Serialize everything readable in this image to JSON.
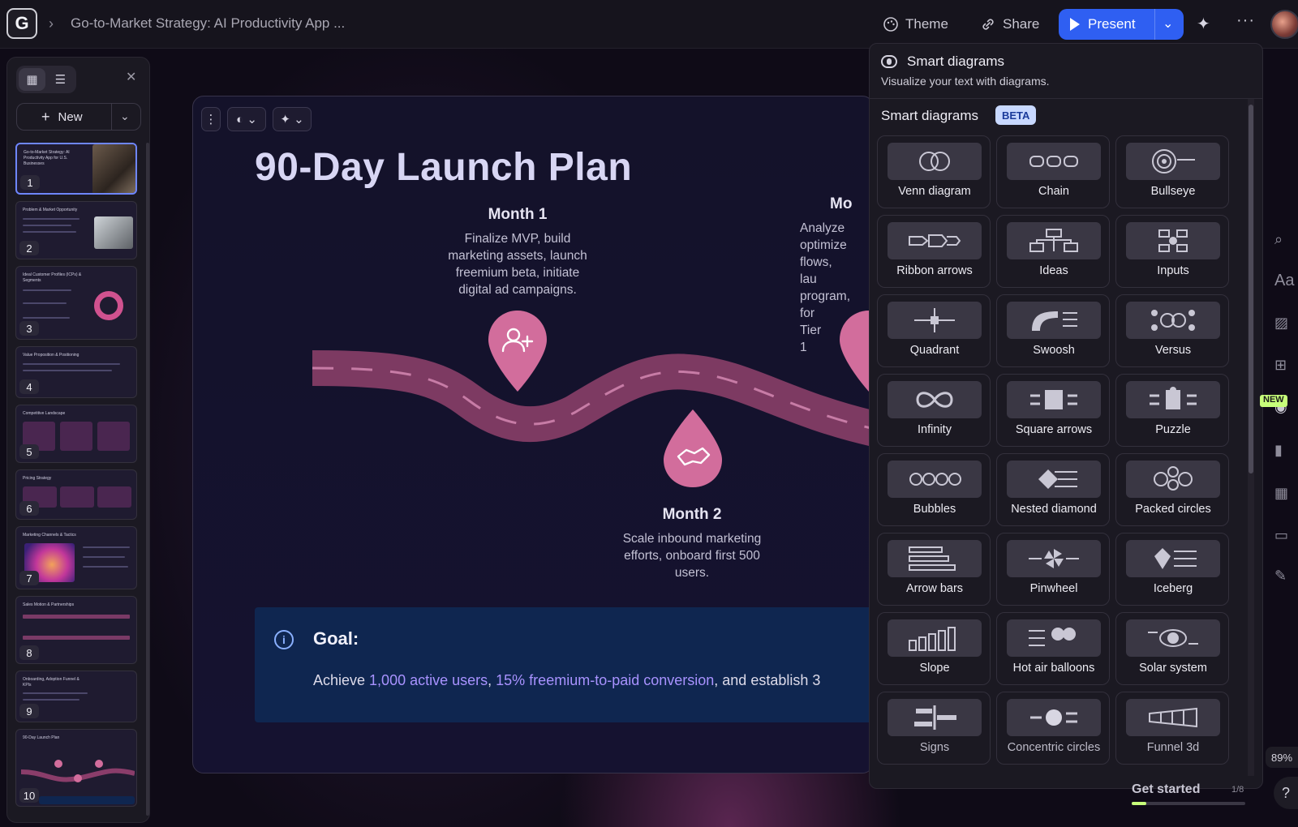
{
  "app": {
    "logo_letter": "G",
    "doc_title": "Go-to-Market Strategy: AI Productivity App ...",
    "theme_label": "Theme",
    "share_label": "Share",
    "present_label": "Present"
  },
  "slides_panel": {
    "new_label": "New",
    "thumbnails": [
      {
        "num": "1",
        "title": "Go-to-Market Strategy: AI Productivity App for U.S. Businesses"
      },
      {
        "num": "2",
        "title": "Problem & Market Opportunity"
      },
      {
        "num": "3",
        "title": "Ideal Customer Profiles (ICPs) & Segments"
      },
      {
        "num": "4",
        "title": "Value Proposition & Positioning"
      },
      {
        "num": "5",
        "title": "Competitive Landscape"
      },
      {
        "num": "6",
        "title": "Pricing Strategy"
      },
      {
        "num": "7",
        "title": "Marketing Channels & Tactics"
      },
      {
        "num": "8",
        "title": "Sales Motion & Partnerships"
      },
      {
        "num": "9",
        "title": "Onboarding, Adoption Funnel & KPIs"
      },
      {
        "num": "10",
        "title": "90-Day Launch Plan"
      }
    ]
  },
  "slide": {
    "title": "90-Day Launch Plan",
    "month1": {
      "title": "Month 1",
      "desc": "Finalize MVP, build marketing assets, launch freemium beta, initiate digital ad campaigns."
    },
    "month2": {
      "title": "Month 2",
      "desc": "Scale inbound marketing efforts, onboard first 500 users."
    },
    "month3": {
      "title": "Mo",
      "desc": "Analyze optimize flows, lau program, for Tier 1"
    },
    "goal_label": "Goal:",
    "goal_prefix": "Achieve ",
    "goal_hl1": "1,000 active users",
    "goal_mid": ", ",
    "goal_hl2": "15% freemium-to-paid conversion",
    "goal_suffix": ", and establish 3"
  },
  "smart_diagrams": {
    "header_title": "Smart diagrams",
    "header_subtitle": "Visualize your text with diagrams.",
    "section_title": "Smart diagrams",
    "badge": "BETA",
    "items": [
      {
        "label": "Venn diagram",
        "icon": "venn"
      },
      {
        "label": "Chain",
        "icon": "chain"
      },
      {
        "label": "Bullseye",
        "icon": "bullseye"
      },
      {
        "label": "Ribbon arrows",
        "icon": "ribbon"
      },
      {
        "label": "Ideas",
        "icon": "ideas"
      },
      {
        "label": "Inputs",
        "icon": "inputs"
      },
      {
        "label": "Quadrant",
        "icon": "quadrant"
      },
      {
        "label": "Swoosh",
        "icon": "swoosh"
      },
      {
        "label": "Versus",
        "icon": "versus"
      },
      {
        "label": "Infinity",
        "icon": "infinity"
      },
      {
        "label": "Square arrows",
        "icon": "square-arrows"
      },
      {
        "label": "Puzzle",
        "icon": "puzzle"
      },
      {
        "label": "Bubbles",
        "icon": "bubbles"
      },
      {
        "label": "Nested diamond",
        "icon": "nested-diamond"
      },
      {
        "label": "Packed circles",
        "icon": "packed-circles"
      },
      {
        "label": "Arrow bars",
        "icon": "arrow-bars"
      },
      {
        "label": "Pinwheel",
        "icon": "pinwheel"
      },
      {
        "label": "Iceberg",
        "icon": "iceberg"
      },
      {
        "label": "Slope",
        "icon": "slope"
      },
      {
        "label": "Hot air balloons",
        "icon": "balloons"
      },
      {
        "label": "Solar system",
        "icon": "solar"
      },
      {
        "label": "Signs",
        "icon": "signs"
      },
      {
        "label": "Concentric circles",
        "icon": "concentric"
      },
      {
        "label": "Funnel 3d",
        "icon": "funnel"
      }
    ]
  },
  "rail": {
    "new_badge": "NEW",
    "zoom": "89%",
    "help": "?"
  },
  "get_started": {
    "label": "Get started",
    "count": "1/8",
    "progress": 0.125
  },
  "colors": {
    "accent": "#2f5ff2",
    "pin": "#d26d9c",
    "road": "#8a3d6a",
    "goal_bg": "#0f2650",
    "highlight": "#a892ff"
  }
}
